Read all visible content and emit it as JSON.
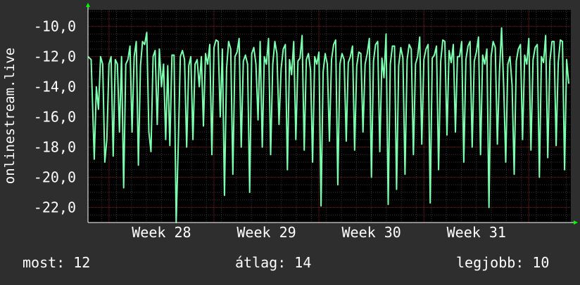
{
  "chart_data": {
    "type": "line",
    "title": "",
    "ylabel": "onlinestream.live",
    "xlabel": "",
    "ylim": [
      -23.0,
      -8.9
    ],
    "x_range_weeks": [
      27.3,
      31.9
    ],
    "yticks": [
      {
        "value": -10,
        "label": "-10,0"
      },
      {
        "value": -12,
        "label": "-12,0"
      },
      {
        "value": -14,
        "label": "-14,0"
      },
      {
        "value": -16,
        "label": "-16,0"
      },
      {
        "value": -18,
        "label": "-18,0"
      },
      {
        "value": -20,
        "label": "-20,0"
      },
      {
        "value": -22,
        "label": "-22,0"
      }
    ],
    "xticks": [
      {
        "value": 28,
        "label": "Week 28"
      },
      {
        "value": 29,
        "label": "Week 29"
      },
      {
        "value": 30,
        "label": "Week 30"
      },
      {
        "value": 31,
        "label": "Week 31"
      }
    ],
    "grid": true,
    "series": [
      {
        "color": "#7dffb0",
        "x": [
          27.3,
          27.33,
          27.36,
          27.38,
          27.4,
          27.42,
          27.44,
          27.46,
          27.48,
          27.5,
          27.52,
          27.54,
          27.56,
          27.58,
          27.6,
          27.62,
          27.64,
          27.66,
          27.68,
          27.7,
          27.72,
          27.74,
          27.76,
          27.78,
          27.8,
          27.82,
          27.84,
          27.86,
          27.88,
          27.9,
          27.92,
          27.94,
          27.96,
          27.98,
          28.0,
          28.02,
          28.04,
          28.06,
          28.08,
          28.1,
          28.12,
          28.14,
          28.16,
          28.18,
          28.2,
          28.22,
          28.24,
          28.26,
          28.28,
          28.3,
          28.32,
          28.34,
          28.36,
          28.38,
          28.4,
          28.42,
          28.44,
          28.46,
          28.48,
          28.5,
          28.52,
          28.54,
          28.56,
          28.58,
          28.6,
          28.62,
          28.64,
          28.66,
          28.68,
          28.7,
          28.72,
          28.74,
          28.76,
          28.78,
          28.8,
          28.82,
          28.84,
          28.86,
          28.88,
          28.9,
          28.92,
          28.94,
          28.96,
          28.98,
          29.0,
          29.02,
          29.04,
          29.06,
          29.08,
          29.1,
          29.12,
          29.14,
          29.16,
          29.18,
          29.2,
          29.22,
          29.24,
          29.26,
          29.28,
          29.3,
          29.32,
          29.34,
          29.36,
          29.38,
          29.4,
          29.42,
          29.44,
          29.46,
          29.48,
          29.5,
          29.52,
          29.54,
          29.56,
          29.58,
          29.6,
          29.62,
          29.64,
          29.66,
          29.68,
          29.7,
          29.72,
          29.74,
          29.76,
          29.78,
          29.8,
          29.82,
          29.84,
          29.86,
          29.88,
          29.9,
          29.92,
          29.94,
          29.96,
          29.98,
          30.0,
          30.02,
          30.04,
          30.06,
          30.08,
          30.1,
          30.12,
          30.14,
          30.16,
          30.18,
          30.2,
          30.22,
          30.24,
          30.26,
          30.28,
          30.3,
          30.32,
          30.34,
          30.36,
          30.38,
          30.4,
          30.42,
          30.44,
          30.46,
          30.48,
          30.5,
          30.52,
          30.54,
          30.56,
          30.58,
          30.6,
          30.62,
          30.64,
          30.66,
          30.68,
          30.7,
          30.72,
          30.74,
          30.76,
          30.78,
          30.8,
          30.82,
          30.84,
          30.86,
          30.88,
          30.9,
          30.92,
          30.94,
          30.96,
          30.98,
          31.0,
          31.02,
          31.04,
          31.06,
          31.08,
          31.1,
          31.12,
          31.14,
          31.16,
          31.18,
          31.2,
          31.22,
          31.24,
          31.26,
          31.28,
          31.3,
          31.32,
          31.34,
          31.36,
          31.38,
          31.4,
          31.42,
          31.44,
          31.46,
          31.48,
          31.5,
          31.52,
          31.54,
          31.56,
          31.58,
          31.6,
          31.62,
          31.64,
          31.66,
          31.68,
          31.7,
          31.72,
          31.74,
          31.76,
          31.78,
          31.8,
          31.82,
          31.84,
          31.86,
          31.88
        ],
        "y": [
          -12.0,
          -12.2,
          -18.8,
          -14.0,
          -15.5,
          -12.0,
          -12.5,
          -19.0,
          -17.5,
          -12.5,
          -12.0,
          -18.6,
          -12.2,
          -12.5,
          -17.0,
          -12.0,
          -20.7,
          -12.5,
          -12.2,
          -11.3,
          -17.0,
          -12.0,
          -11.0,
          -19.2,
          -12.6,
          -11.0,
          -11.2,
          -10.4,
          -17.0,
          -18.3,
          -12.0,
          -11.6,
          -16.5,
          -11.5,
          -14.0,
          -12.5,
          -17.5,
          -12.6,
          -17.9,
          -11.9,
          -11.9,
          -23.0,
          -17.8,
          -12.0,
          -11.6,
          -12.2,
          -18.0,
          -12.6,
          -12.0,
          -17.5,
          -12.5,
          -12.2,
          -14.0,
          -12.0,
          -16.6,
          -11.8,
          -12.5,
          -11.2,
          -18.5,
          -11.4,
          -10.9,
          -11.0,
          -16.0,
          -11.5,
          -21.2,
          -12.8,
          -11.0,
          -11.5,
          -19.8,
          -12.0,
          -11.7,
          -10.8,
          -18.0,
          -12.3,
          -11.9,
          -12.5,
          -21.0,
          -11.8,
          -11.4,
          -12.5,
          -16.2,
          -11.0,
          -18.0,
          -12.0,
          -12.5,
          -10.8,
          -18.5,
          -12.5,
          -11.0,
          -11.8,
          -16.5,
          -12.8,
          -11.5,
          -11.2,
          -19.5,
          -12.2,
          -13.2,
          -11.0,
          -17.5,
          -12.3,
          -12.1,
          -10.6,
          -18.2,
          -12.2,
          -11.8,
          -12.9,
          -19.0,
          -12.0,
          -12.5,
          -11.7,
          -21.9,
          -13.0,
          -11.8,
          -12.5,
          -17.6,
          -12.2,
          -11.2,
          -10.9,
          -20.5,
          -12.5,
          -11.8,
          -12.2,
          -17.6,
          -12.4,
          -12.0,
          -11.3,
          -18.2,
          -12.6,
          -11.7,
          -11.8,
          -17.0,
          -12.5,
          -11.8,
          -10.8,
          -20.0,
          -12.3,
          -11.2,
          -11.0,
          -18.3,
          -12.1,
          -13.4,
          -10.5,
          -21.8,
          -12.5,
          -11.3,
          -11.3,
          -20.8,
          -12.6,
          -11.4,
          -12.1,
          -19.8,
          -12.2,
          -11.2,
          -11.5,
          -18.5,
          -12.5,
          -12.0,
          -10.7,
          -17.8,
          -12.2,
          -11.5,
          -11.2,
          -21.7,
          -12.1,
          -11.9,
          -11.3,
          -19.5,
          -12.3,
          -10.9,
          -11.0,
          -17.2,
          -11.6,
          -12.4,
          -11.2,
          -17.0,
          -12.0,
          -12.0,
          -11.0,
          -19.0,
          -12.2,
          -11.3,
          -11.0,
          -18.0,
          -12.3,
          -11.7,
          -10.7,
          -18.5,
          -11.9,
          -12.5,
          -11.5,
          -22.0,
          -12.0,
          -11.0,
          -11.4,
          -17.8,
          -13.0,
          -10.1,
          -14.0,
          -19.0,
          -12.5,
          -12.0,
          -13.9,
          -19.8,
          -12.3,
          -11.5,
          -11.2,
          -17.5,
          -11.9,
          -12.5,
          -10.8,
          -18.2,
          -12.2,
          -11.4,
          -11.2,
          -20.0,
          -12.0,
          -12.4,
          -10.6,
          -18.7,
          -12.3,
          -11.0,
          -11.0,
          -17.9,
          -12.4,
          -10.9,
          -11.0,
          -19.5,
          -12.2,
          -13.8
        ]
      }
    ]
  },
  "stats": {
    "most": "most: 12",
    "atlag": "átlag: 14",
    "legjobb": "legjobb: 10"
  },
  "colors": {
    "background": "#2e2e2e",
    "plot_background": "#000000",
    "line": "#7dffb0",
    "major_grid": "#8a1f1f",
    "minor_grid": "#3a3a3a",
    "axis": "#ffffff",
    "arrow": "#00ff00"
  }
}
